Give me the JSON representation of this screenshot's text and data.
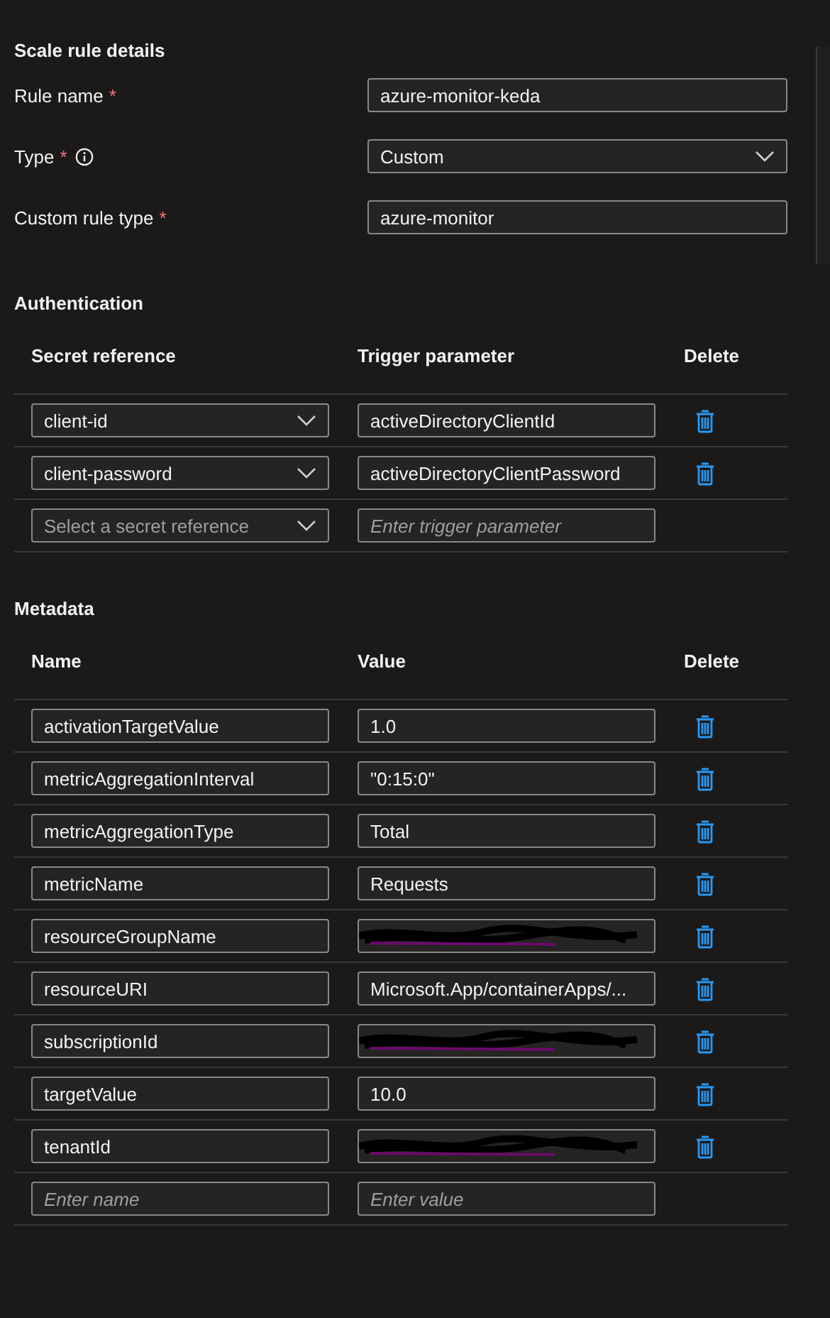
{
  "title": "Scale rule details",
  "fields": [
    {
      "label": "Rule name",
      "required_mark": "*",
      "info": false,
      "kind": "text",
      "value": "azure-monitor-keda"
    },
    {
      "label": "Type",
      "required_mark": "*",
      "info": true,
      "kind": "dropdown",
      "value": "Custom"
    },
    {
      "label": "Custom rule type",
      "required_mark": "*",
      "info": false,
      "kind": "text",
      "value": "azure-monitor"
    }
  ],
  "authentication": {
    "title": "Authentication",
    "columns": [
      "Secret reference",
      "Trigger parameter",
      "Delete"
    ],
    "rows": [
      {
        "secret": {
          "value": "client-id"
        },
        "parameter": {
          "value": "activeDirectoryClientId"
        },
        "deletable": true
      },
      {
        "secret": {
          "value": "client-password"
        },
        "parameter": {
          "value": "activeDirectoryClientPassword"
        },
        "deletable": true
      },
      {
        "secret": {
          "placeholder": "Select a secret reference"
        },
        "parameter": {
          "placeholder": "Enter trigger parameter"
        },
        "deletable": false
      }
    ]
  },
  "metadata": {
    "title": "Metadata",
    "columns": [
      "Name",
      "Value",
      "Delete"
    ],
    "rows": [
      {
        "name": {
          "value": "activationTargetValue"
        },
        "value": {
          "value": "1.0"
        },
        "deletable": true
      },
      {
        "name": {
          "value": "metricAggregationInterval"
        },
        "value": {
          "value": "\"0:15:0\""
        },
        "deletable": true
      },
      {
        "name": {
          "value": "metricAggregationType"
        },
        "value": {
          "value": "Total"
        },
        "deletable": true
      },
      {
        "name": {
          "value": "metricName"
        },
        "value": {
          "value": "Requests"
        },
        "deletable": true
      },
      {
        "name": {
          "value": "resourceGroupName"
        },
        "value": {
          "redacted": true
        },
        "deletable": true
      },
      {
        "name": {
          "value": "resourceURI"
        },
        "value": {
          "value": "Microsoft.App/containerApps/..."
        },
        "deletable": true
      },
      {
        "name": {
          "value": "subscriptionId"
        },
        "value": {
          "redacted": true
        },
        "deletable": true
      },
      {
        "name": {
          "value": "targetValue"
        },
        "value": {
          "value": "10.0"
        },
        "deletable": true
      },
      {
        "name": {
          "value": "tenantId"
        },
        "value": {
          "redacted": true
        },
        "deletable": true
      },
      {
        "name": {
          "placeholder": "Enter name"
        },
        "value": {
          "placeholder": "Enter value"
        },
        "deletable": false
      }
    ]
  }
}
